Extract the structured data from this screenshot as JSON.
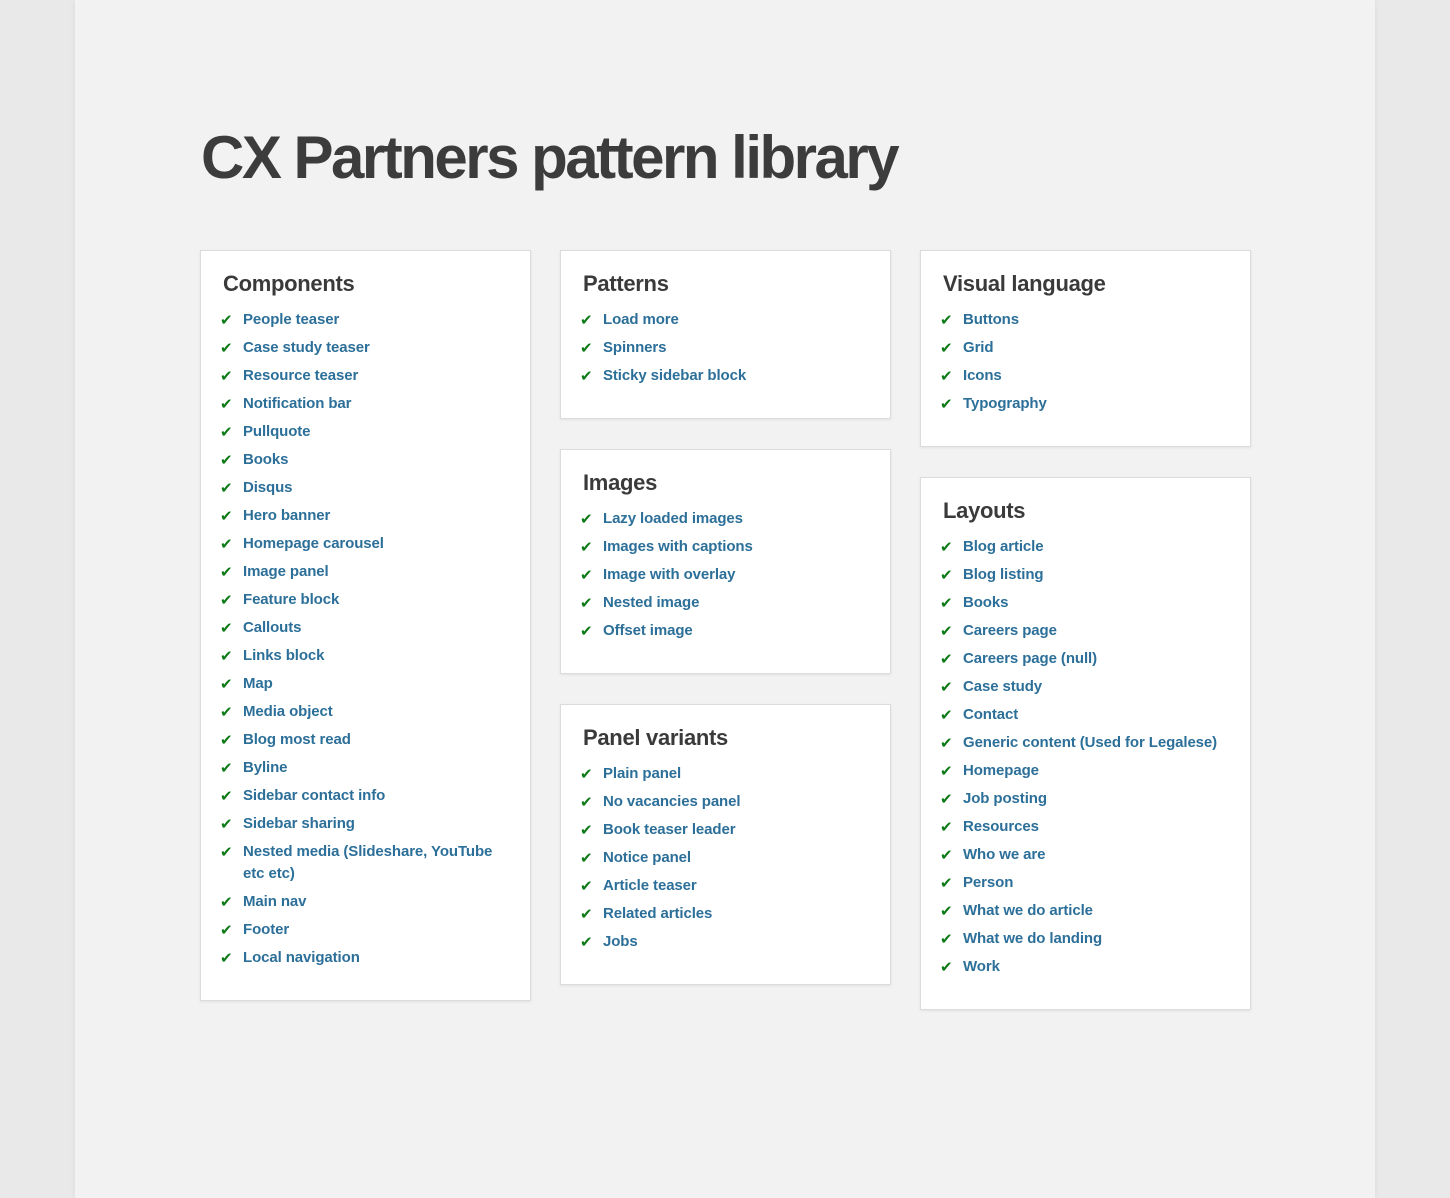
{
  "title": "CX Partners pattern library",
  "colors": {
    "link": "#2c6f99",
    "check": "#0d7a17",
    "heading": "#3c3c3c",
    "background": "#f2f2f2",
    "card": "#ffffff"
  },
  "check_icon": "✔",
  "sections": {
    "components": {
      "heading": "Components",
      "items": [
        "People teaser",
        "Case study teaser",
        "Resource teaser",
        "Notification bar",
        "Pullquote",
        "Books",
        "Disqus",
        "Hero banner",
        "Homepage carousel",
        "Image panel",
        "Feature block",
        "Callouts",
        "Links block",
        "Map",
        "Media object",
        "Blog most read",
        "Byline",
        "Sidebar contact info",
        "Sidebar sharing",
        "Nested media (Slideshare, YouTube etc etc)",
        "Main nav",
        "Footer",
        "Local navigation"
      ]
    },
    "patterns": {
      "heading": "Patterns",
      "items": [
        "Load more",
        "Spinners",
        "Sticky sidebar block"
      ]
    },
    "images": {
      "heading": "Images",
      "items": [
        "Lazy loaded images",
        "Images with captions",
        "Image with overlay",
        "Nested image",
        "Offset image"
      ]
    },
    "panel_variants": {
      "heading": "Panel variants",
      "items": [
        "Plain panel",
        "No vacancies panel",
        "Book teaser leader",
        "Notice panel",
        "Article teaser",
        "Related articles",
        "Jobs"
      ]
    },
    "visual_language": {
      "heading": "Visual language",
      "items": [
        "Buttons",
        "Grid",
        "Icons",
        "Typography"
      ]
    },
    "layouts": {
      "heading": "Layouts",
      "items": [
        "Blog article",
        "Blog listing",
        "Books",
        "Careers page",
        "Careers page (null)",
        "Case study",
        "Contact",
        "Generic content (Used for Legalese)",
        "Homepage",
        "Job posting",
        "Resources",
        "Who we are",
        "Person",
        "What we do article",
        "What we do landing",
        "Work"
      ]
    }
  }
}
